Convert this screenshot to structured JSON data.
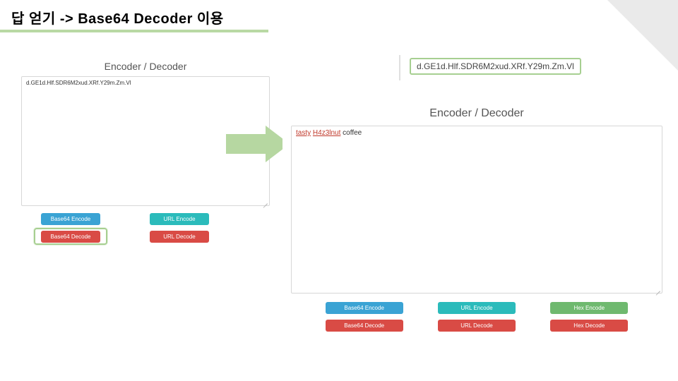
{
  "slide": {
    "title": "답 얻기 -> Base64 Decoder 이용"
  },
  "callout": {
    "encoded_text": "d.GE1d.Hlf.SDR6M2xud.XRf.Y29m.Zm.Vl"
  },
  "panel_left": {
    "title": "Encoder / Decoder",
    "textarea_value": "d.GE1d.Hlf.SDR6M2xud.XRf.Y29m.Zm.Vl",
    "buttons": {
      "b64_encode": "Base64 Encode",
      "url_encode": "URL Encode",
      "b64_decode": "Base64 Decode",
      "url_decode": "URL Decode"
    }
  },
  "panel_right": {
    "title": "Encoder / Decoder",
    "decoded_prefix": "tasty",
    "decoded_mid": "H4z3lnut",
    "decoded_suffix": "coffee",
    "buttons": {
      "b64_encode": "Base64 Encode",
      "url_encode": "URL Encode",
      "hex_encode": "Hex Encode",
      "b64_decode": "Base64 Decode",
      "url_decode": "URL Decode",
      "hex_decode": "Hex Decode"
    }
  }
}
